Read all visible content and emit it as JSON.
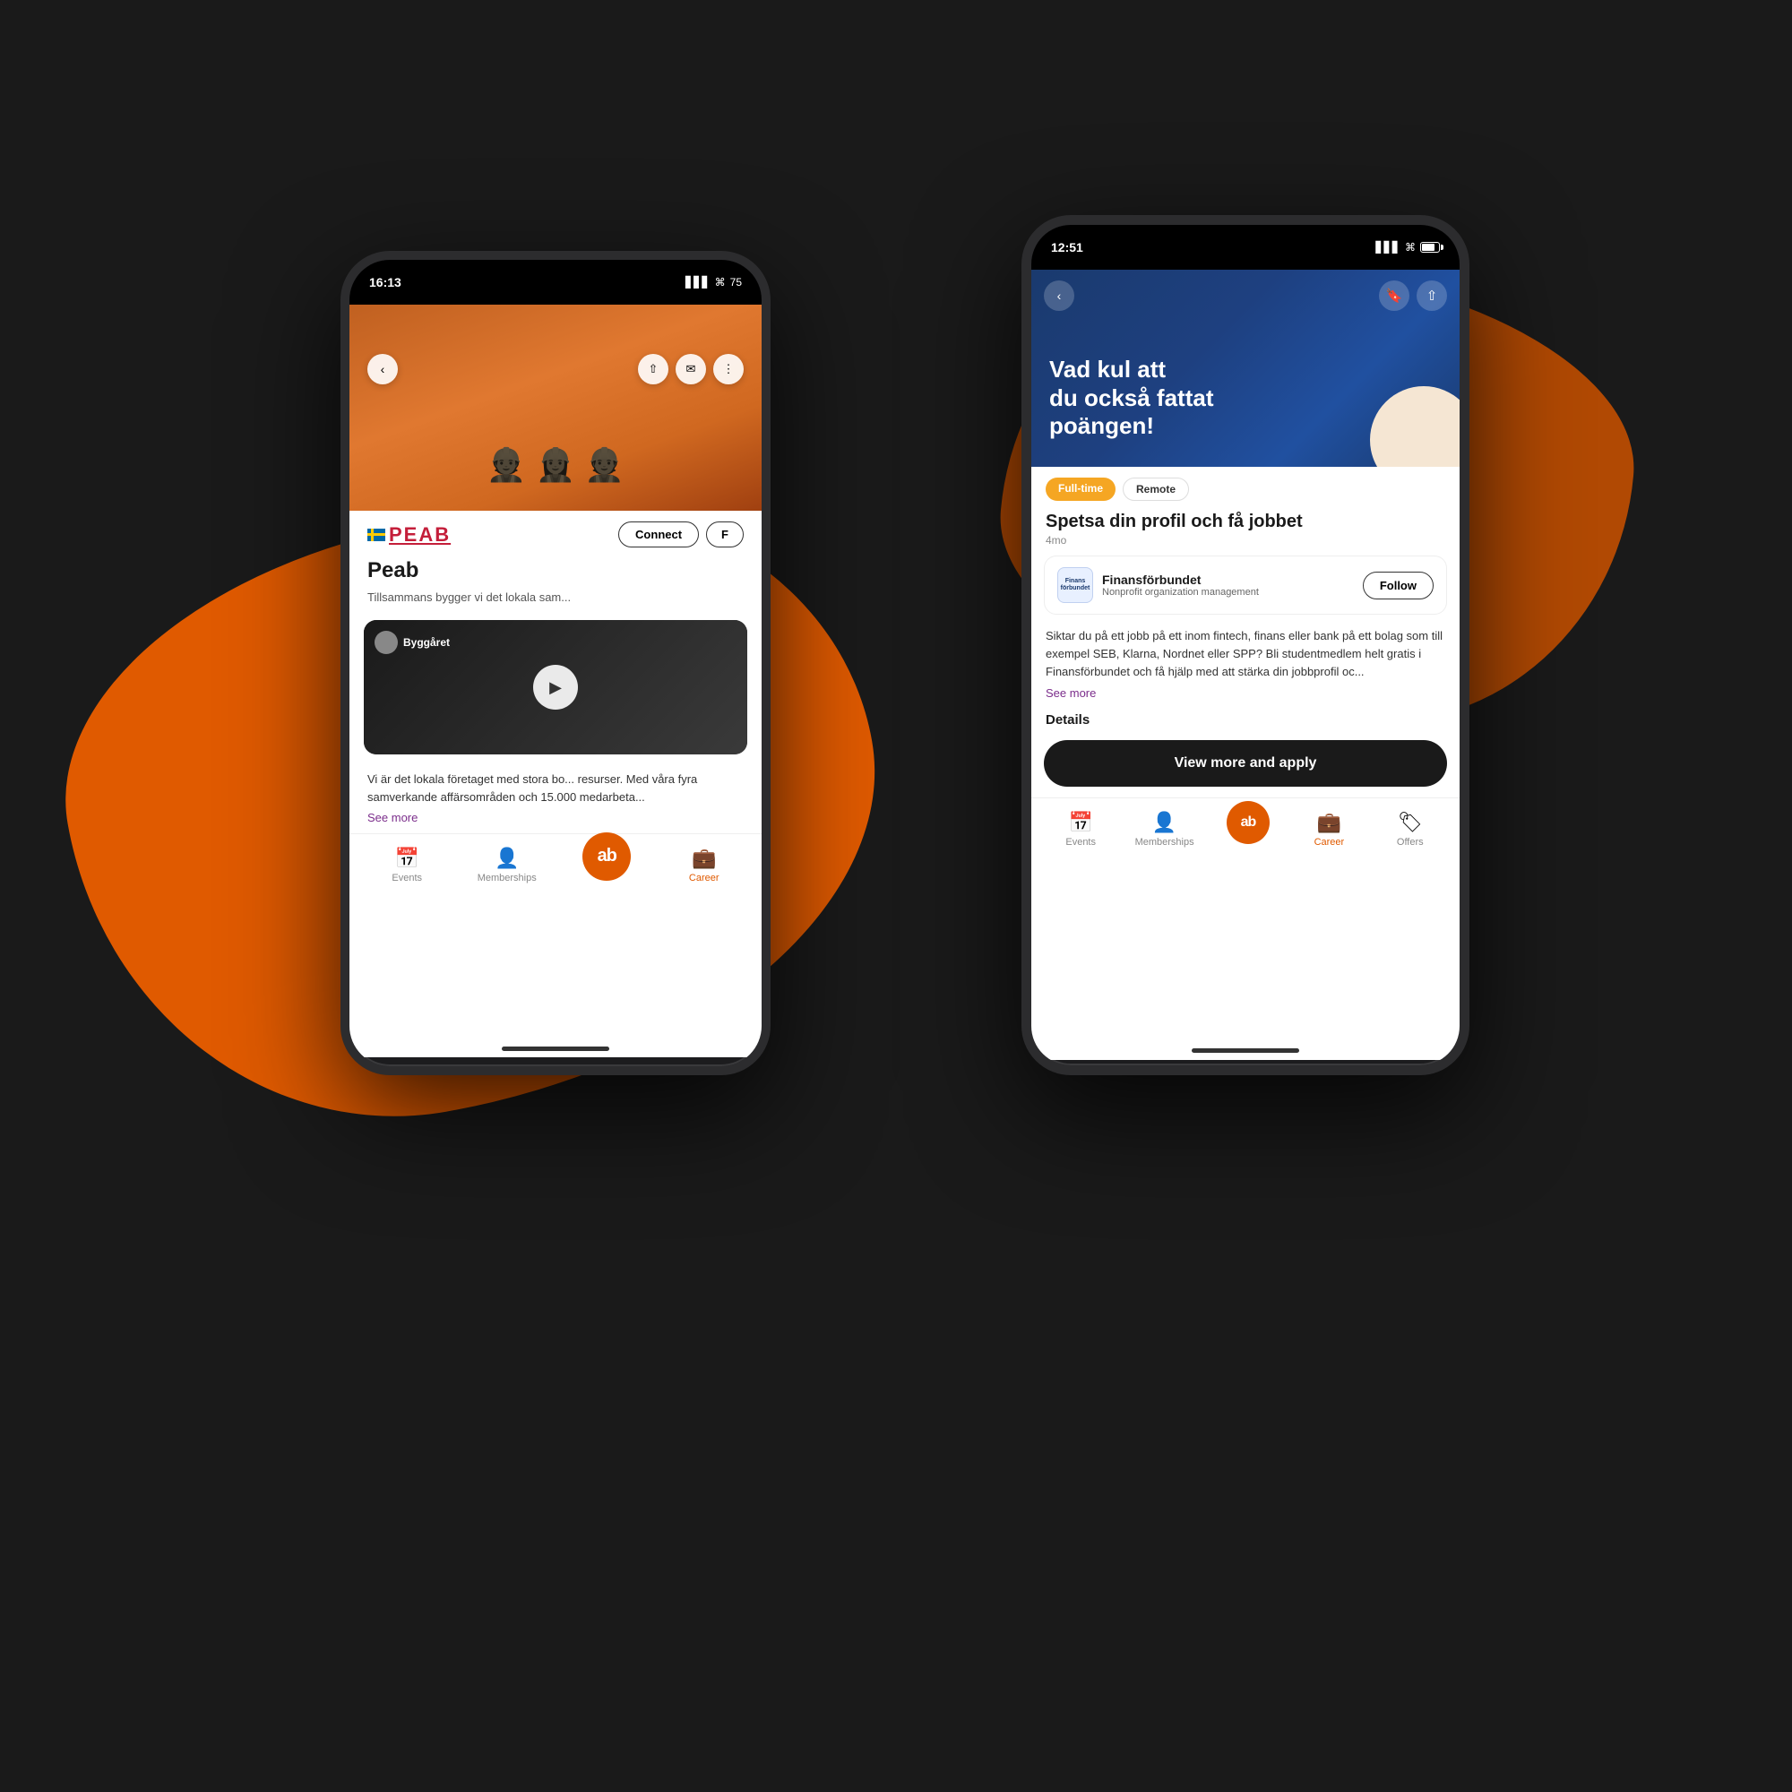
{
  "background": {
    "color": "#1a1a1a"
  },
  "phone_back": {
    "status_time": "16:13",
    "battery": "75",
    "company": "Peab",
    "tagline": "Tillsammans bygger vi det lokala sam...",
    "description": "Vi är det lokala företaget med stora bo... resurser. Med våra fyra samverkande affärsområden och 15.000 medarbeta...",
    "video_title": "Byggåret",
    "connect_label": "Connect",
    "follow_label": "F",
    "see_more_label": "See more",
    "nav": {
      "events_label": "Events",
      "memberships_label": "Memberships",
      "career_label": "Career"
    }
  },
  "phone_front": {
    "status_time": "12:51",
    "hero_headline_line1": "Vad kul att",
    "hero_headline_line2": "du också fattat",
    "hero_headline_line3": "poängen!",
    "tag_fulltime": "Full-time",
    "tag_remote": "Remote",
    "job_title": "Spetsa din profil och få jobbet",
    "job_time": "4mo",
    "company_name": "Finansförbundet",
    "company_type": "Nonprofit organization management",
    "follow_label": "Follow",
    "description": "Siktar du på ett jobb på ett inom fintech, finans eller bank på ett bolag som till exempel SEB, Klarna, Nordnet eller SPP? Bli studentmedlem helt gratis i Finansförbundet och få hjälp med att stärka din jobbprofil oc...",
    "see_more_label": "See more",
    "details_label": "Details",
    "apply_label": "View more and apply",
    "nav": {
      "events_label": "Events",
      "memberships_label": "Memberships",
      "career_label": "Career",
      "offers_label": "Offers"
    }
  }
}
